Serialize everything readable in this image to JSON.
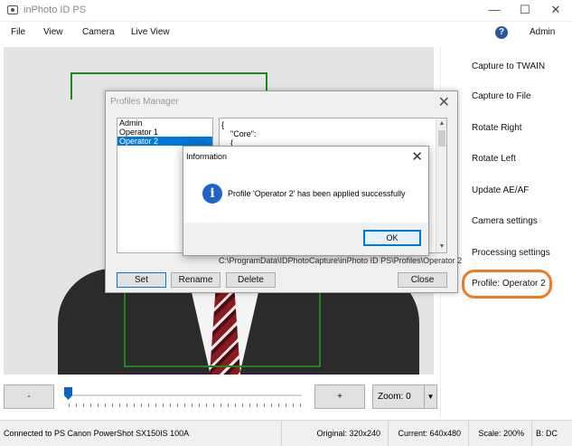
{
  "window": {
    "title": "inPhoto ID PS",
    "controls": {
      "minimize": "—",
      "maximize": "☐",
      "close": "✕"
    }
  },
  "menu": {
    "items": [
      "File",
      "View",
      "Camera",
      "Live View"
    ],
    "help_icon": "?",
    "admin": "Admin"
  },
  "right_panel": {
    "items": [
      "Capture to TWAIN",
      "Capture to File",
      "Rotate Right",
      "Rotate Left",
      "Update AE/AF",
      "Camera settings",
      "Processing settings"
    ],
    "profile": "Profile: Operator 2",
    "profile_highlight_color": "#f07a22"
  },
  "controls": {
    "zoom_out": "-",
    "zoom_in": "+",
    "zoom_value": "Zoom: 0",
    "slider_value": 0
  },
  "status": {
    "connection": "Connected to PS Canon PowerShot SX150IS 100A",
    "original": "Original: 320x240",
    "current": "Current: 640x480",
    "scale": "Scale: 200%",
    "b": "B: DC"
  },
  "profiles_manager": {
    "title": "Profiles Manager",
    "close": "✕",
    "profiles": [
      "Admin",
      "Operator 1",
      "Operator 2"
    ],
    "selected": "Operator 2",
    "json_lines": [
      "{",
      "    \"Core\":",
      "    {"
    ],
    "path": "C:\\ProgramData\\IDPhotoCapture\\inPhoto ID PS\\Profiles\\Operator 2",
    "buttons": {
      "set": "Set",
      "rename": "Rename",
      "delete": "Delete",
      "close": "Close"
    }
  },
  "info_dialog": {
    "title": "Information",
    "close": "✕",
    "icon": "i",
    "message": "Profile 'Operator 2' has been applied successfully",
    "ok": "OK"
  }
}
